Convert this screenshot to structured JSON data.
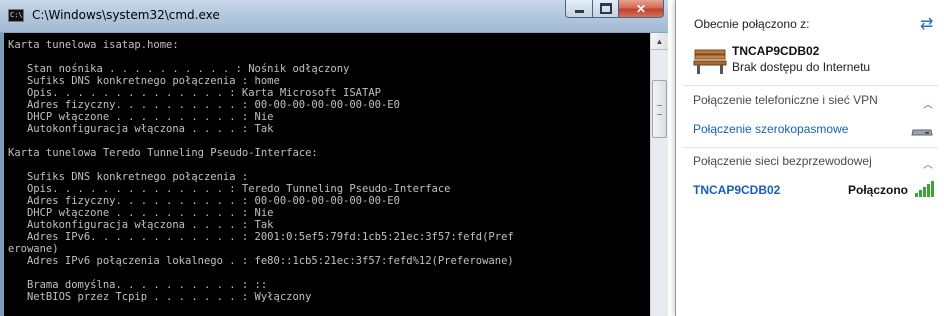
{
  "cmd_window": {
    "title": "C:\\Windows\\system32\\cmd.exe",
    "icon_label": "C:\\",
    "buttons": {
      "minimize": "minimize",
      "maximize": "maximize",
      "close": "✕"
    },
    "console_lines": [
      "Karta tunelowa isatap.home:",
      "",
      "   Stan nośnika . . . . . . . . . . : Nośnik odłączony",
      "   Sufiks DNS konkretnego połączenia : home",
      "   Opis. . . . . . . . . . . . . . : Karta Microsoft ISATAP",
      "   Adres fizyczny. . . . . . . . . . : 00-00-00-00-00-00-00-E0",
      "   DHCP włączone . . . . . . . . . . : Nie",
      "   Autokonfiguracja włączona . . . . : Tak",
      "",
      "Karta tunelowa Teredo Tunneling Pseudo-Interface:",
      "",
      "   Sufiks DNS konkretnego połączenia :",
      "   Opis. . . . . . . . . . . . . . : Teredo Tunneling Pseudo-Interface",
      "   Adres fizyczny. . . . . . . . . . : 00-00-00-00-00-00-00-E0",
      "   DHCP włączone . . . . . . . . . . : Nie",
      "   Autokonfiguracja włączona . . . . : Tak",
      "   Adres IPv6. . . . . . . . . . . . : 2001:0:5ef5:79fd:1cb5:21ec:3f57:fefd(Pref",
      "erowane)",
      "   Adres IPv6 połączenia lokalnego . : fe80::1cb5:21ec:3f57:fefd%12(Preferowane)",
      "",
      "   Brama domyślna. . . . . . . . . . : ::",
      "   NetBIOS przez Tcpip . . . . . . . : Wyłączony"
    ]
  },
  "flyout": {
    "connected_label": "Obecnie połączono z:",
    "current_network": {
      "name": "TNCAP9CDB02",
      "status": "Brak dostępu do Internetu"
    },
    "dialup_section": {
      "header": "Połączenie telefoniczne i sieć VPN",
      "items": [
        {
          "label": "Połączenie szerokopasmowe"
        }
      ]
    },
    "wireless_section": {
      "header": "Połączenie sieci bezprzewodowej",
      "items": [
        {
          "name": "TNCAP9CDB02",
          "status": "Połączono"
        }
      ]
    },
    "colors": {
      "link": "#1a5fb4",
      "signal": "#3aa33a"
    }
  }
}
